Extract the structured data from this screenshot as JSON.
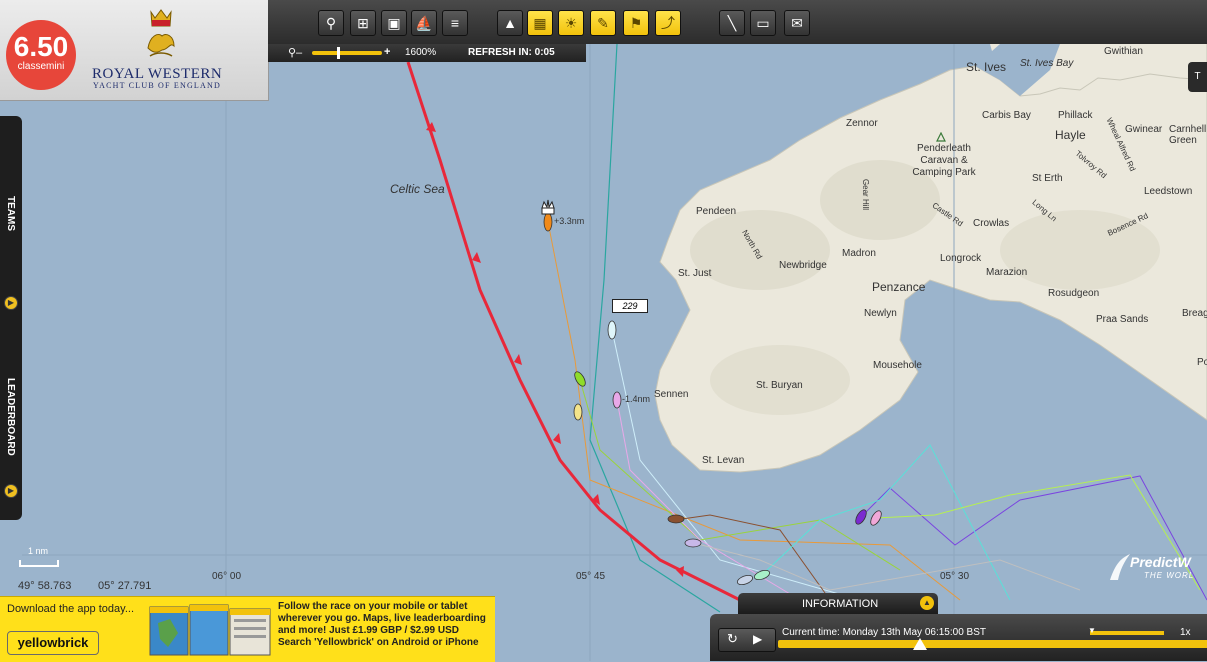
{
  "logo": {
    "number": "6.50",
    "class": "classemini"
  },
  "club": {
    "name": "ROYAL WESTERN",
    "sub": "YACHT CLUB OF ENGLAND"
  },
  "zoom": {
    "level": "1600%",
    "refresh": "REFRESH IN: 0:05",
    "slider_fraction": 0.35
  },
  "sidebar": {
    "teams": "TEAMS",
    "leaderboard": "LEADERBOARD"
  },
  "map": {
    "sea_label": "Celtic Sea",
    "places": [
      "St. Ives",
      "St. Ives Bay",
      "Gwithian",
      "Zennor",
      "Carbis Bay",
      "Phillack",
      "Hayle",
      "Gwinear",
      "Carnhell Green",
      "Penderleath Caravan & Camping Park",
      "St Erth",
      "Leedstown",
      "Pendeen",
      "North Rd",
      "Gear Hill",
      "Castle Rd",
      "Crowlas",
      "Long Ln",
      "Bosence Rd",
      "Tolvroy Rd",
      "Wheal Alfred Rd",
      "St. Just",
      "Newbridge",
      "Madron",
      "Longrock",
      "Marazion",
      "Penzance",
      "Newlyn",
      "Rosudgeon",
      "Praa Sands",
      "Breag",
      "Mousehole",
      "Sennen",
      "St. Buryan",
      "St. Levan",
      "Po"
    ],
    "boat_labels": {
      "leader": "+3.3nm",
      "second": "-1.4nm",
      "tag": "229"
    },
    "grid": {
      "lon1": "06° 00",
      "lon2": "05° 45",
      "lon3": "05° 30"
    },
    "scale": "1 nm",
    "cursor_lat": "49° 58.763",
    "cursor_lon": "05° 27.791",
    "watermark": "PredictW",
    "watermark_sub": "THE WORL",
    "right_btn": "T"
  },
  "banner": {
    "download": "Download the app today...",
    "brand": "yellowbrick",
    "line1": "Follow the race on your mobile or tablet",
    "line2": "wherever you go. Maps, live leaderboarding",
    "line3": "and more! Just £1.99 GBP / $2.99 USD",
    "line4": "Search 'Yellowbrick' on Android or iPhone"
  },
  "info": {
    "label": "INFORMATION"
  },
  "timeline": {
    "current": "Current time: Monday 13th May 06:15:00 BST",
    "speed": "1x",
    "progress": 0.33
  },
  "colors": {
    "accent": "#f2c20c",
    "track_red": "#e8283a",
    "sea": "#9bb4cc",
    "land": "#ebe8dc"
  }
}
